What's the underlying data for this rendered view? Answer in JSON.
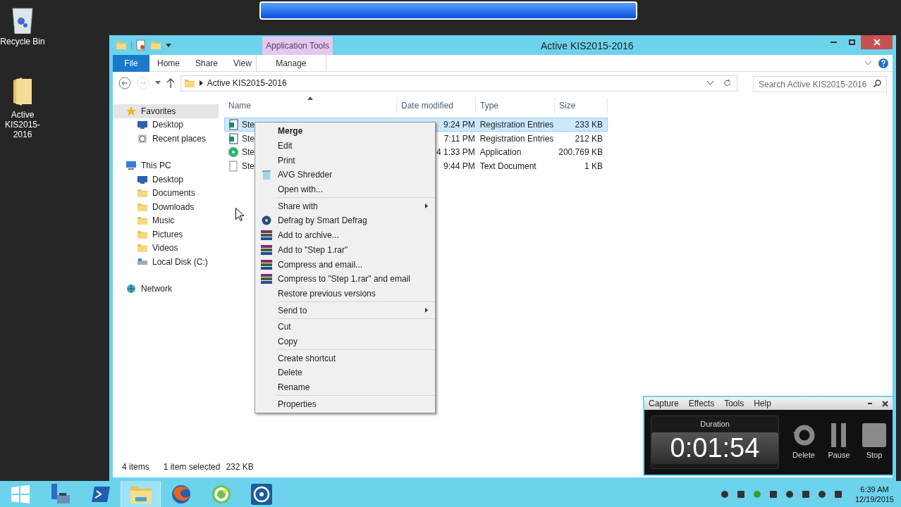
{
  "desktop_icons": [
    {
      "label": "Recycle Bin",
      "kind": "bin"
    },
    {
      "label": "Active KIS2015-2016",
      "kind": "folder"
    }
  ],
  "explorer": {
    "title": "Active KIS2015-2016",
    "context_group": "Application Tools",
    "tabs": [
      {
        "label": "File",
        "kind": "file"
      },
      {
        "label": "Home",
        "kind": "tab"
      },
      {
        "label": "Share",
        "kind": "tab"
      },
      {
        "label": "View",
        "kind": "tab"
      },
      {
        "label": "Manage",
        "kind": "context"
      }
    ],
    "address": "Active KIS2015-2016",
    "search": {
      "placeholder": "Search Active KIS2015-2016"
    },
    "nav": [
      {
        "label": "Favorites",
        "kind": "favorites",
        "selected": true,
        "children": [
          {
            "label": "Desktop",
            "kind": "desktop",
            "selected": false
          },
          {
            "label": "Recent places",
            "kind": "recent",
            "selected": false
          }
        ]
      },
      {
        "label": "This PC",
        "kind": "pc",
        "selected": false,
        "children": [
          {
            "label": "Desktop",
            "kind": "desktop",
            "selected": false
          },
          {
            "label": "Documents",
            "kind": "folder",
            "selected": false
          },
          {
            "label": "Downloads",
            "kind": "folder",
            "selected": false
          },
          {
            "label": "Music",
            "kind": "folder",
            "selected": false
          },
          {
            "label": "Pictures",
            "kind": "folder",
            "selected": false
          },
          {
            "label": "Videos",
            "kind": "folder",
            "selected": false
          },
          {
            "label": "Local Disk (C:)",
            "kind": "disk",
            "selected": false
          }
        ]
      },
      {
        "label": "Network",
        "kind": "network",
        "selected": false
      }
    ],
    "columns": [
      "Name",
      "Date modified",
      "Type",
      "Size"
    ],
    "rows": [
      {
        "name": "Ste",
        "date": "9:24 PM",
        "type": "Registration Entries",
        "size": "233 KB",
        "kind": "reg",
        "selected": true
      },
      {
        "name": "Ste",
        "date": "7:11 PM",
        "type": "Registration Entries",
        "size": "212 KB",
        "kind": "reg",
        "selected": false
      },
      {
        "name": "Ste",
        "date": "4 1:33 PM",
        "type": "Application",
        "size": "200,769 KB",
        "kind": "app",
        "selected": false
      },
      {
        "name": "Ste",
        "date": "9:44 PM",
        "type": "Text Document",
        "size": "1 KB",
        "kind": "txt",
        "selected": false
      }
    ],
    "status": [
      "4 items",
      "1 item selected",
      "232 KB"
    ]
  },
  "context_menu": [
    [
      {
        "label": "Merge",
        "kind": "default"
      },
      {
        "label": "Edit",
        "kind": "plain"
      },
      {
        "label": "Print",
        "kind": "plain"
      },
      {
        "label": "AVG Shredder",
        "kind": "shredder"
      },
      {
        "label": "Open with...",
        "kind": "plain"
      }
    ],
    [
      {
        "label": "Share with",
        "kind": "submenu"
      },
      {
        "label": "Defrag by Smart Defrag",
        "kind": "defrag"
      },
      {
        "label": "Add to archive...",
        "kind": "archive"
      },
      {
        "label": "Add to \"Step 1.rar\"",
        "kind": "archive"
      },
      {
        "label": "Compress and email...",
        "kind": "archive"
      },
      {
        "label": "Compress to \"Step 1.rar\" and email",
        "kind": "archive"
      },
      {
        "label": "Restore previous versions",
        "kind": "plain"
      }
    ],
    [
      {
        "label": "Send to",
        "kind": "submenu"
      }
    ],
    [
      {
        "label": "Cut",
        "kind": "plain"
      },
      {
        "label": "Copy",
        "kind": "plain"
      }
    ],
    [
      {
        "label": "Create shortcut",
        "kind": "plain"
      },
      {
        "label": "Delete",
        "kind": "plain"
      },
      {
        "label": "Rename",
        "kind": "plain"
      }
    ],
    [
      {
        "label": "Properties",
        "kind": "plain"
      }
    ]
  ],
  "recorder": {
    "menu": [
      "Capture",
      "Effects",
      "Tools",
      "Help"
    ],
    "caption": "Duration",
    "time": "0:01:54",
    "buttons": [
      {
        "label": "Delete",
        "kind": "delete"
      },
      {
        "label": "Pause",
        "kind": "pause"
      },
      {
        "label": "Stop",
        "kind": "stop"
      }
    ]
  },
  "taskbar": {
    "apps": [
      {
        "kind": "start",
        "selected": false
      },
      {
        "kind": "server",
        "selected": false
      },
      {
        "kind": "shell",
        "selected": false
      },
      {
        "kind": "explorer",
        "selected": true
      },
      {
        "kind": "browser",
        "selected": false
      },
      {
        "kind": "cleaner",
        "selected": false
      },
      {
        "kind": "recorder",
        "selected": false
      }
    ],
    "time": "6:39 AM",
    "date": "12/19/2015"
  }
}
